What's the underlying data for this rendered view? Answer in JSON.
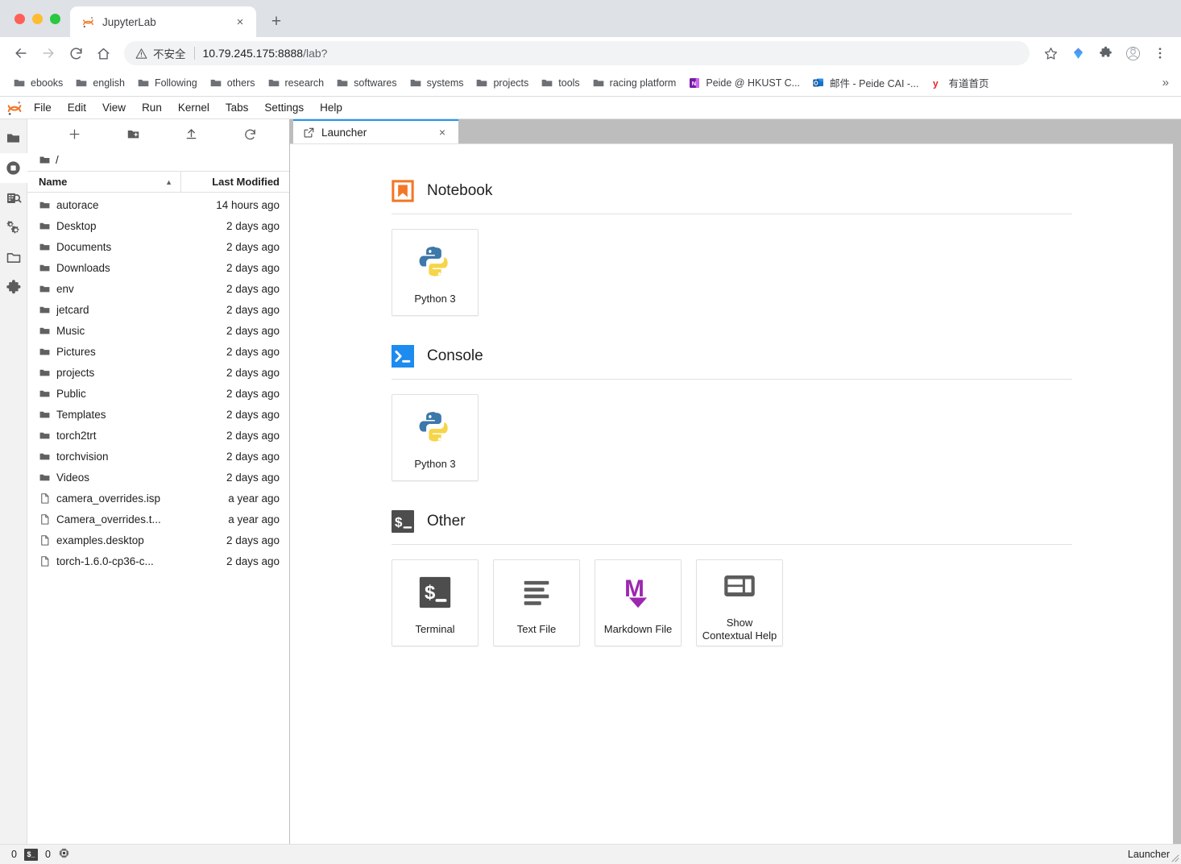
{
  "browser": {
    "tab": {
      "title": "JupyterLab",
      "favicon": "jupyter-logo-icon",
      "close": "×"
    },
    "new_tab_label": "+",
    "nav": {
      "back": "←",
      "forward": "→",
      "reload": "↻",
      "home": "⌂"
    },
    "omnibox": {
      "security_label": "不安全",
      "security_icon": "warning-triangle-icon",
      "url_host": "10.79.245.175:8888",
      "url_path": "/lab?"
    },
    "toolbar_icons": [
      "star-icon",
      "diamond-extension-icon",
      "puzzle-extensions-icon",
      "profile-avatar-icon",
      "three-dot-menu-icon"
    ],
    "bookmarks": [
      {
        "label": "ebooks",
        "icon": "folder-icon"
      },
      {
        "label": "english",
        "icon": "folder-icon"
      },
      {
        "label": "Following",
        "icon": "folder-icon"
      },
      {
        "label": "others",
        "icon": "folder-icon"
      },
      {
        "label": "research",
        "icon": "folder-icon"
      },
      {
        "label": "softwares",
        "icon": "folder-icon"
      },
      {
        "label": "systems",
        "icon": "folder-icon"
      },
      {
        "label": "projects",
        "icon": "folder-icon"
      },
      {
        "label": "tools",
        "icon": "folder-icon"
      },
      {
        "label": "racing platform",
        "icon": "folder-icon"
      },
      {
        "label": "Peide @ HKUST C...",
        "icon": "onenote-icon"
      },
      {
        "label": "邮件 - Peide CAI -...",
        "icon": "outlook-icon"
      },
      {
        "label": "有道首页",
        "icon": "youdao-icon"
      }
    ],
    "bookmarks_overflow": "»"
  },
  "jupyter": {
    "menubar": [
      "File",
      "Edit",
      "View",
      "Run",
      "Kernel",
      "Tabs",
      "Settings",
      "Help"
    ],
    "rail": [
      {
        "name": "file-browser",
        "icon": "folder-icon",
        "active": true
      },
      {
        "name": "running-sessions",
        "icon": "stop-circle-icon",
        "active": false
      },
      {
        "name": "command-palette",
        "icon": "command-search-icon",
        "active": false
      },
      {
        "name": "property-inspector",
        "icon": "gears-icon",
        "active": false
      },
      {
        "name": "open-tabs",
        "icon": "open-folder-icon",
        "active": false
      },
      {
        "name": "extension-manager",
        "icon": "puzzle-icon",
        "active": false
      }
    ],
    "filebrowser": {
      "toolbar": [
        {
          "name": "new-launcher",
          "icon": "plus-icon",
          "label": "+"
        },
        {
          "name": "new-folder",
          "icon": "new-folder-icon",
          "label": ""
        },
        {
          "name": "upload",
          "icon": "upload-icon",
          "label": ""
        },
        {
          "name": "refresh",
          "icon": "refresh-icon",
          "label": ""
        }
      ],
      "breadcrumb": "/",
      "columns": {
        "name": "Name",
        "last_modified": "Last Modified"
      },
      "sort_indicator": "▲",
      "items": [
        {
          "name": "autorace",
          "modified": "14 hours ago",
          "type": "folder"
        },
        {
          "name": "Desktop",
          "modified": "2 days ago",
          "type": "folder"
        },
        {
          "name": "Documents",
          "modified": "2 days ago",
          "type": "folder"
        },
        {
          "name": "Downloads",
          "modified": "2 days ago",
          "type": "folder"
        },
        {
          "name": "env",
          "modified": "2 days ago",
          "type": "folder"
        },
        {
          "name": "jetcard",
          "modified": "2 days ago",
          "type": "folder"
        },
        {
          "name": "Music",
          "modified": "2 days ago",
          "type": "folder"
        },
        {
          "name": "Pictures",
          "modified": "2 days ago",
          "type": "folder"
        },
        {
          "name": "projects",
          "modified": "2 days ago",
          "type": "folder"
        },
        {
          "name": "Public",
          "modified": "2 days ago",
          "type": "folder"
        },
        {
          "name": "Templates",
          "modified": "2 days ago",
          "type": "folder"
        },
        {
          "name": "torch2trt",
          "modified": "2 days ago",
          "type": "folder"
        },
        {
          "name": "torchvision",
          "modified": "2 days ago",
          "type": "folder"
        },
        {
          "name": "Videos",
          "modified": "2 days ago",
          "type": "folder"
        },
        {
          "name": "camera_overrides.isp",
          "modified": "a year ago",
          "type": "file"
        },
        {
          "name": "Camera_overrides.t...",
          "modified": "a year ago",
          "type": "file"
        },
        {
          "name": "examples.desktop",
          "modified": "2 days ago",
          "type": "file"
        },
        {
          "name": "torch-1.6.0-cp36-c...",
          "modified": "2 days ago",
          "type": "file"
        }
      ]
    },
    "doc_tab": {
      "label": "Launcher",
      "icon": "launcher-icon",
      "close": "×"
    },
    "launcher": {
      "sections": [
        {
          "title": "Notebook",
          "icon": "notebook-bookmark-icon",
          "cards": [
            {
              "label": "Python 3",
              "icon": "python-logo-icon"
            }
          ]
        },
        {
          "title": "Console",
          "icon": "console-prompt-icon",
          "cards": [
            {
              "label": "Python 3",
              "icon": "python-logo-icon"
            }
          ]
        },
        {
          "title": "Other",
          "icon": "terminal-dollar-icon",
          "cards": [
            {
              "label": "Terminal",
              "icon": "terminal-dollar-icon"
            },
            {
              "label": "Text File",
              "icon": "text-lines-icon"
            },
            {
              "label": "Markdown File",
              "icon": "markdown-m-icon"
            },
            {
              "label": "Show\nContextual Help",
              "icon": "contextual-help-panels-icon"
            }
          ]
        }
      ]
    },
    "statusbar": {
      "terminal_count": "0",
      "terminal_icon": "terminal-chip-icon",
      "kernel_count": "0",
      "kernel_icon": "cpu-chip-icon",
      "right_label": "Launcher"
    }
  },
  "colors": {
    "accent_blue": "#2196f3",
    "jupyter_orange": "#f37726",
    "console_blue": "#1e8bf0",
    "markdown_purple": "#9c27b0",
    "terminal_dark": "#424242",
    "chrome_tabstrip": "#dee1e6"
  }
}
